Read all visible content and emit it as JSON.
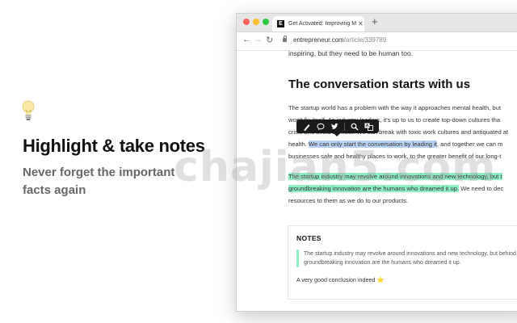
{
  "promo": {
    "title": "Highlight & take notes",
    "subtitle": "Never forget the important facts again",
    "icon": "lightbulb-icon"
  },
  "browser": {
    "tab_title": "Get Activated: Improving Ment",
    "favicon_letter": "E",
    "url_domain": "entrepreneur.com",
    "url_path": "/article/339789",
    "traffic_lights": [
      "#fe5f57",
      "#febc2e",
      "#28c840"
    ]
  },
  "article": {
    "text_top": "inspiring, but they need to be human too.",
    "heading": "The conversation starts with us",
    "para1_lines": [
      "The startup world has a problem with the way it approaches mental health, but",
      "won't fix itself. As industry leaders, it's up to us to create top-down cultures tha",
      "crisis and avoid burnout. We can break with toxic work cultures and antiquated at",
      "businesses safe and healthy places to work, to the greater benefit of our long-t"
    ],
    "para1_line4_pre": "health. ",
    "para1_line4_highlight": "We can only start the conversation by leading it",
    "para1_line4_post": ", and together we can m",
    "para2_hl1": "The startup industry may revolve around innovations and new technology, but t",
    "para2_hl2": "groundbreaking innovation are the humans who dreamed it up.",
    "para2_line2_post": " We need to dec",
    "para2_line3": "resources to them as we do to our products."
  },
  "tooltip": {
    "icons": [
      "highlighter-icon",
      "comment-icon",
      "twitter-icon",
      "search-icon",
      "translate-icon"
    ]
  },
  "notes": {
    "title": "NOTES",
    "quote_line1": "The startup industry may revolve around innovations and new technology, but behind",
    "quote_line2": "groundbreaking innovation are the humans who dreamed it up.",
    "note": "A very good conclusion indeed",
    "note_emoji": "⭐"
  },
  "watermark": "chajian5.com",
  "colors": {
    "highlight_blue": "#b7d3f5",
    "highlight_green": "#8eefc4",
    "tooltip_bg": "#1b1b1b"
  }
}
